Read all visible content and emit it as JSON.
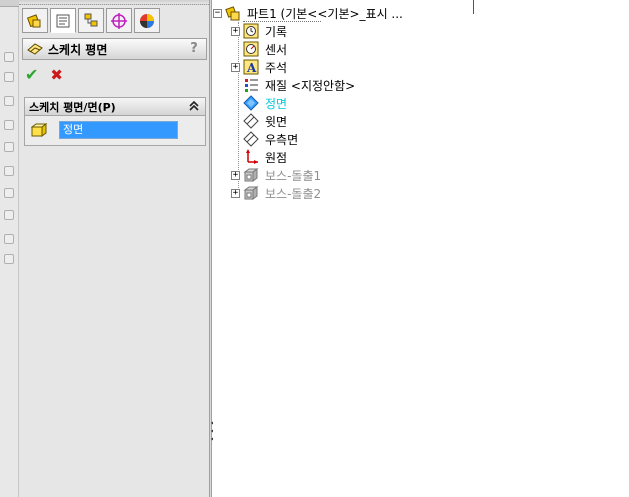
{
  "property_manager": {
    "title": "스케치 평면",
    "help": "?",
    "ok_symbol": "✔",
    "cancel_symbol": "✖",
    "group": {
      "title": "스케치 평면/면(P)",
      "collapse_symbol": "⌃",
      "selection": "정면"
    },
    "tabs": [
      {
        "name": "feature-manager-tab",
        "icon": "part-tree-icon"
      },
      {
        "name": "property-manager-tab",
        "icon": "property-sheet-icon"
      },
      {
        "name": "configuration-manager-tab",
        "icon": "configuration-icon"
      },
      {
        "name": "dimxpert-tab",
        "icon": "target-icon"
      },
      {
        "name": "display-manager-tab",
        "icon": "appearance-icon"
      }
    ]
  },
  "tree": {
    "root": "파트1  (기본<<기본>_표시 ...",
    "items": [
      {
        "label": "기록",
        "expandable": true,
        "icon": "history-icon",
        "style": "normal"
      },
      {
        "label": "센서",
        "expandable": false,
        "icon": "sensor-icon",
        "style": "normal"
      },
      {
        "label": "주석",
        "expandable": true,
        "icon": "annotation-icon",
        "style": "normal"
      },
      {
        "label": "재질 <지정안함>",
        "expandable": false,
        "icon": "material-icon",
        "style": "normal"
      },
      {
        "label": "정면",
        "expandable": false,
        "icon": "plane-icon",
        "style": "selected"
      },
      {
        "label": "윗면",
        "expandable": false,
        "icon": "plane-icon",
        "style": "normal"
      },
      {
        "label": "우측면",
        "expandable": false,
        "icon": "plane-icon",
        "style": "normal"
      },
      {
        "label": "원점",
        "expandable": false,
        "icon": "origin-icon",
        "style": "normal"
      },
      {
        "label": "보스-돌출1",
        "expandable": true,
        "icon": "extrude-icon",
        "style": "suppressed"
      },
      {
        "label": "보스-돌출2",
        "expandable": true,
        "icon": "extrude-icon",
        "style": "suppressed"
      }
    ]
  },
  "colors": {
    "selection_bg": "#3399ff",
    "selected_item": "#00c8d8",
    "ok": "#2fa52f",
    "cancel": "#cc1a1a"
  }
}
